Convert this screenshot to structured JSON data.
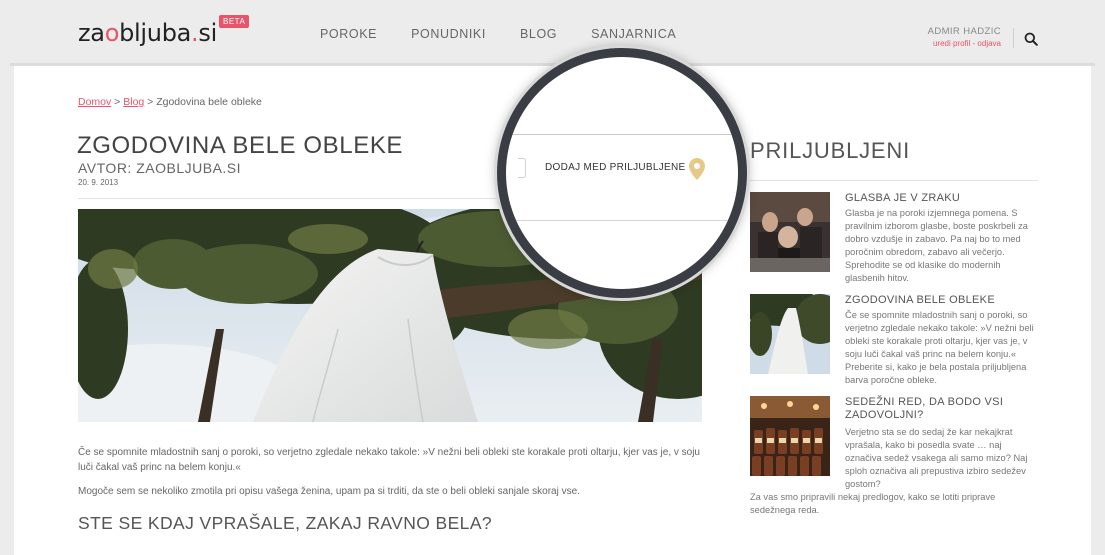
{
  "header": {
    "logo_pre": "za",
    "logo_ring": "o",
    "logo_mid": "bljuba",
    "logo_dot": ".",
    "logo_tld": "si",
    "beta": "BETA",
    "nav": [
      "POROKE",
      "PONUDNIKI",
      "BLOG",
      "SANJARNICA"
    ],
    "user_name": "ADMIR HADZIC",
    "user_links": "uredi profil - odjava",
    "search_icon": "search-icon"
  },
  "breadcrumb": {
    "home": "Domov",
    "sep1": " > ",
    "blog": "Blog",
    "sep2": " > ",
    "current": "Zgodovina bele obleke"
  },
  "article": {
    "title": "ZGODOVINA BELE OBLEKE",
    "author": "AVTOR: ZAOBLJUBA.SI",
    "date": "20. 9. 2013",
    "favorite_label": "DODAJ MED PRILJUBLJENE",
    "favorite_icon": "pin-icon",
    "paragraph1": "Če se spomnite mladostnih sanj o poroki, so verjetno zgledale nekako takole: »V nežni beli obleki ste korakale proti oltarju, kjer vas je, v soju luči čakal vaš princ na belem konju.«",
    "paragraph2": "Mogoče sem se nekoliko zmotila pri opisu vašega ženina, upam pa si trditi, da ste o beli obleki sanjale skoraj vse.",
    "subheading": "STE SE KDAJ VPRAŠALE, ZAKAJ RAVNO BELA?"
  },
  "sidebar": {
    "title": "PRILJUBLJENI",
    "items": [
      {
        "title": "GLASBA JE V ZRAKU",
        "text": "Glasba je na poroki izjemnega pomena. S pravilnim izborom glasbe, boste poskrbeli za dobro vzdušje in zabavo. Pa naj bo to med poročnim obredom, zabavo ali večerjo. Sprehodite se od klasike do modernih glasbenih hitov."
      },
      {
        "title": "ZGODOVINA BELE OBLEKE",
        "text": "Če se spomnite mladostnih sanj o poroki, so verjetno zgledale nekako takole: »V nežni beli obleki ste korakale proti oltarju, kjer vas je, v soju luči čakal vaš princ na belem konju.« Preberite si, kako je bela postala priljubljena barva poročne obleke."
      },
      {
        "title": "SEDEŽNI RED, DA BODO VSI ZADOVOLJNI?",
        "text": "Verjetno sta se do sedaj že kar nekajkrat vprašala, kako bi posedla svate … naj označiva sedež vsakega ali samo mizo? Naj sploh označiva ali prepustiva izbiro sedežev gostom?",
        "text2": "Za vas smo pripravili nekaj predlogov, kako se lotiti priprave sedežnega reda."
      }
    ]
  },
  "colors": {
    "accent": "#e8556b",
    "background": "#ececec",
    "magnifier_ring": "#3a3d44",
    "pin": "#e6c98a"
  }
}
